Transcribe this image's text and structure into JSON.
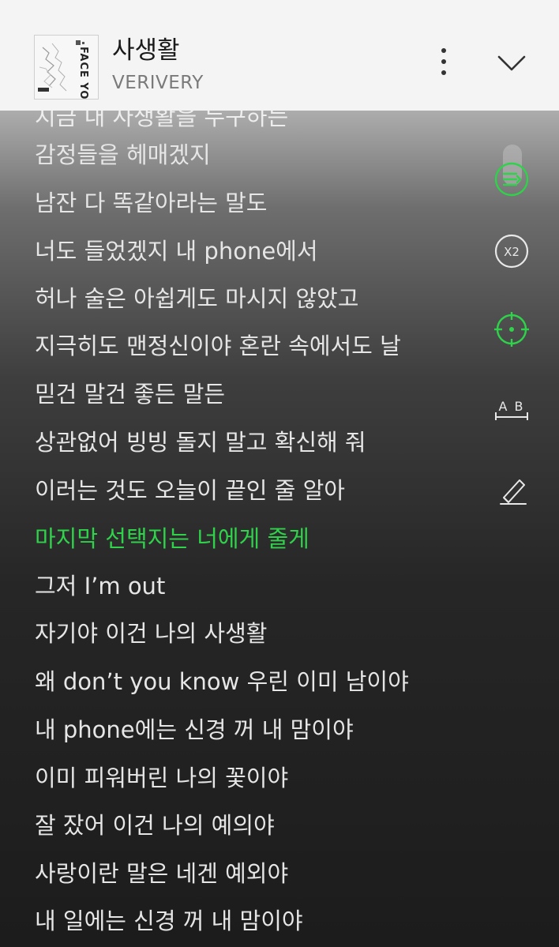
{
  "header": {
    "song_title": "사생활",
    "artist": "VERIVERY",
    "album_art": {
      "label": "FACE YOU"
    }
  },
  "lyrics": {
    "faded_line": "지금 내 사생활을 누구하는",
    "lines": [
      "감정들을 헤매겠지",
      "남잔 다 똑같아라는 말도",
      "너도 들었겠지 내 phone에서",
      "허나 술은 아쉽게도 마시지 않았고",
      "지극히도 맨정신이야 혼란 속에서도 날",
      "믿건 말건 좋든 말든",
      "상관없어 빙빙 돌지 말고 확신해 줘",
      "이러는 것도 오늘이 끝인 줄 알아",
      "마지막 선택지는 너에게 줄게",
      "그저 I’m out",
      "자기야 이건 나의 사생활",
      "왜 don’t you know 우린 이미 남이야",
      "내 phone에는 신경 꺼 내 맘이야",
      "이미 피워버린 나의 꽃이야",
      "잘 잤어 이건 나의 예의야",
      "사랑이란 말은 네겐 예외야",
      "내 일에는 신경 꺼 내 맘이야"
    ],
    "current_index": 8
  },
  "side_controls": {
    "speed_label": "X2",
    "translate_label": "A B"
  },
  "colors": {
    "accent": "#2fd24a",
    "lyric_text": "#e6e6e6",
    "icon_white": "#e8e8e8"
  }
}
